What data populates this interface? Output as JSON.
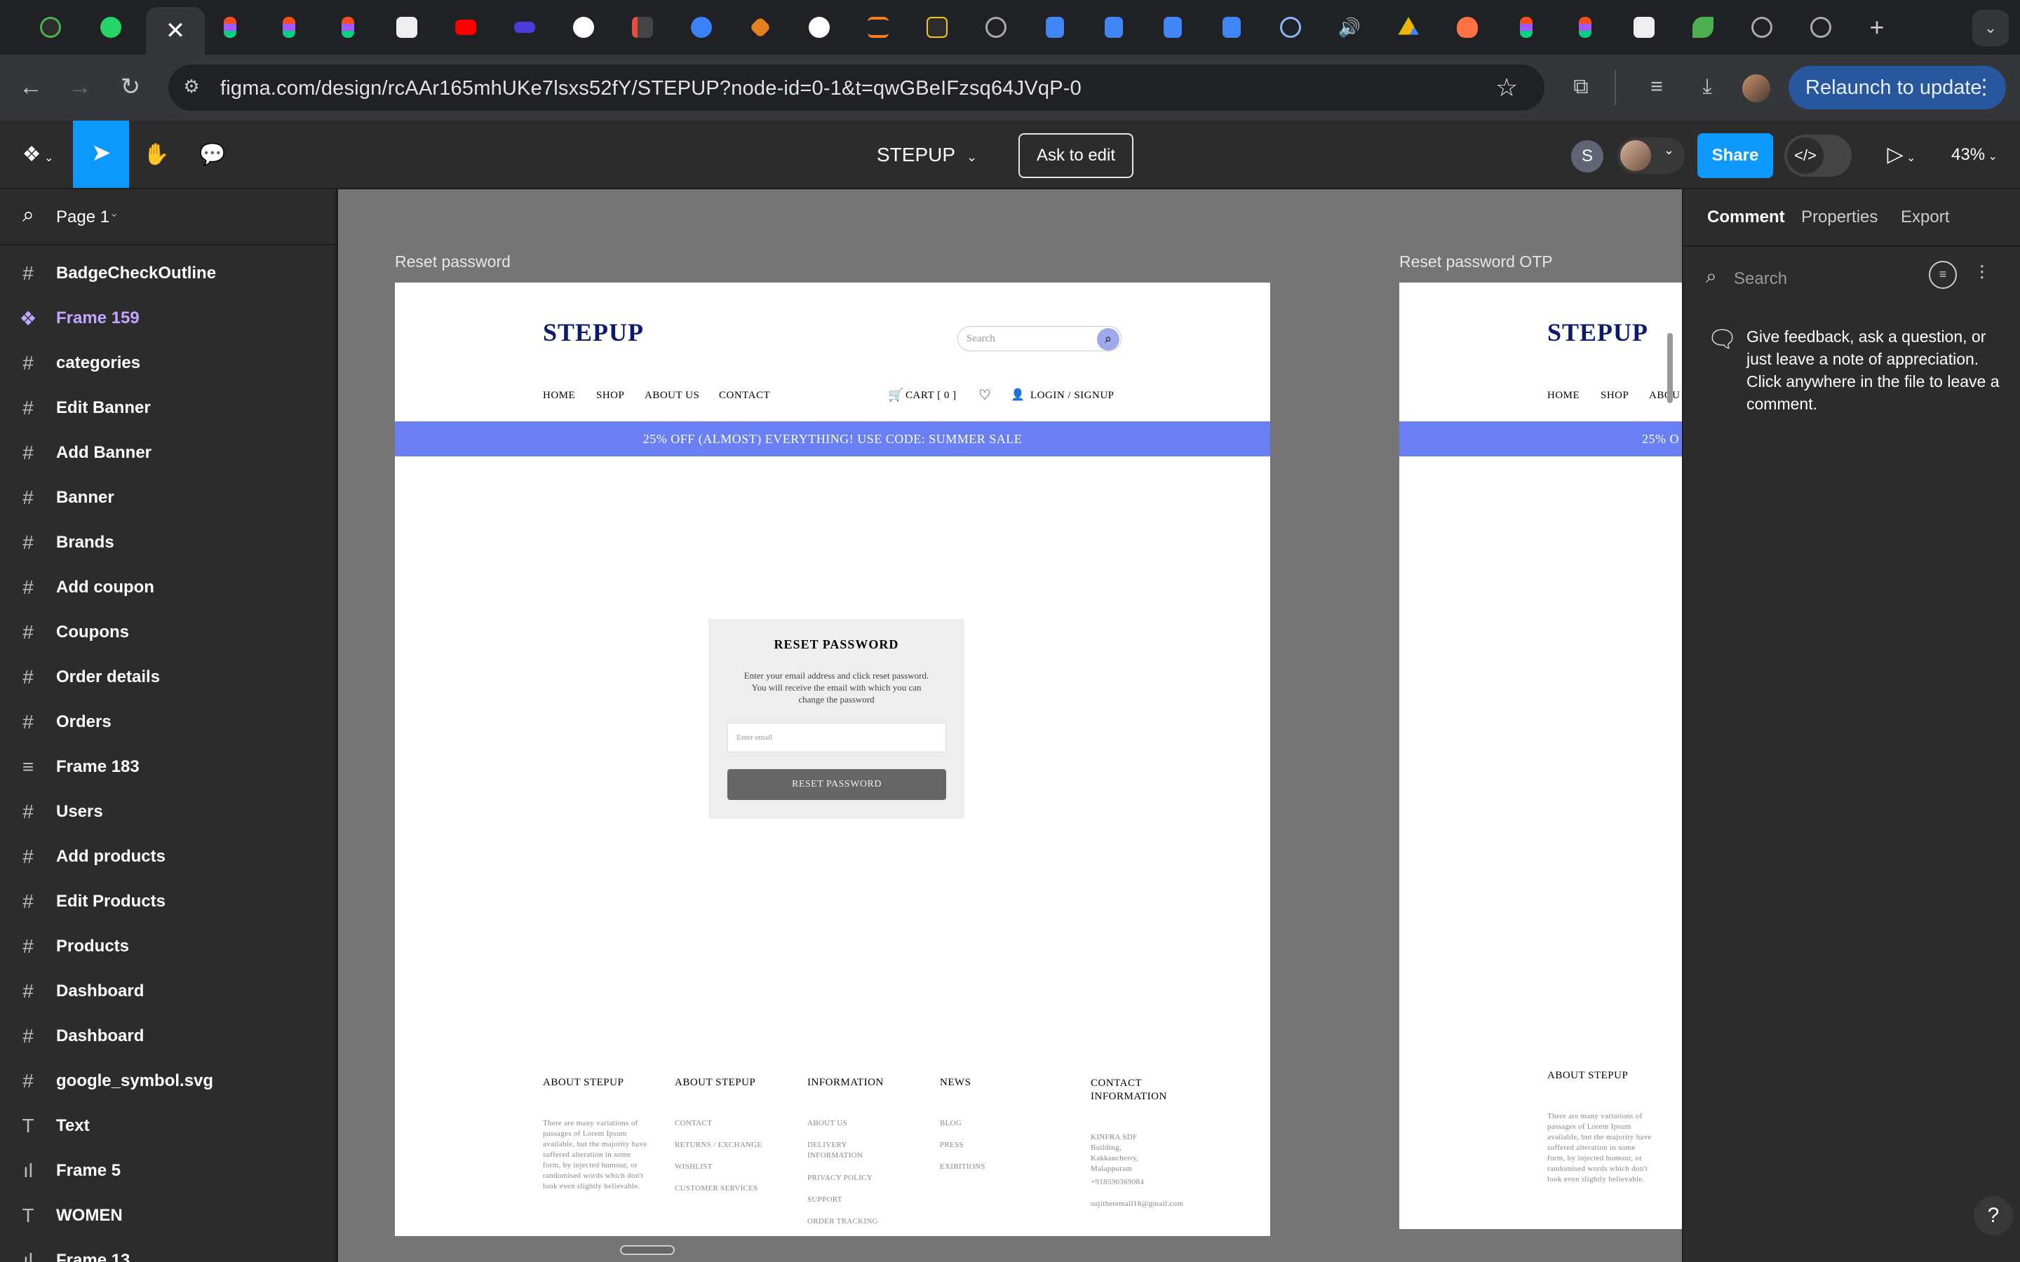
{
  "browser": {
    "url": "figma.com/design/rcAAr165mhUKe7lsxs52fY/STEPUP?node-id=0-1&t=qwGBeIFzsq64JVqP-0",
    "relaunch_label": "Relaunch to update"
  },
  "toolbar": {
    "file_name": "STEPUP",
    "ask_to_edit": "Ask to edit",
    "avatar_initial": "S",
    "share_label": "Share",
    "zoom": "43%"
  },
  "sidebar": {
    "page_label": "Page 1",
    "layers": [
      {
        "icon": "frame-icon",
        "label": "BadgeCheckOutline"
      },
      {
        "icon": "component-icon",
        "label": "Frame 159"
      },
      {
        "icon": "frame-icon",
        "label": "categories"
      },
      {
        "icon": "frame-icon",
        "label": "Edit Banner"
      },
      {
        "icon": "frame-icon",
        "label": "Add Banner"
      },
      {
        "icon": "frame-icon",
        "label": "Banner"
      },
      {
        "icon": "frame-icon",
        "label": "Brands"
      },
      {
        "icon": "frame-icon",
        "label": "Add coupon"
      },
      {
        "icon": "frame-icon",
        "label": "Coupons"
      },
      {
        "icon": "frame-icon",
        "label": "Order details"
      },
      {
        "icon": "frame-icon",
        "label": "Orders"
      },
      {
        "icon": "autolayout-icon",
        "label": "Frame 183"
      },
      {
        "icon": "frame-icon",
        "label": "Users"
      },
      {
        "icon": "frame-icon",
        "label": "Add products"
      },
      {
        "icon": "frame-icon",
        "label": "Edit Products"
      },
      {
        "icon": "frame-icon",
        "label": "Products"
      },
      {
        "icon": "frame-icon",
        "label": "Dashboard"
      },
      {
        "icon": "frame-icon",
        "label": "Dashboard"
      },
      {
        "icon": "frame-icon",
        "label": "google_symbol.svg"
      },
      {
        "icon": "text-icon",
        "label": "Text"
      },
      {
        "icon": "bars-icon",
        "label": "Frame 5"
      },
      {
        "icon": "text-icon",
        "label": "WOMEN"
      },
      {
        "icon": "bars-icon",
        "label": "Frame 13"
      }
    ]
  },
  "canvas": {
    "frame1_label": "Reset password",
    "frame2_label": "Reset password OTP",
    "site": {
      "logo": "STEPUP",
      "search_placeholder": "Search",
      "nav": {
        "home": "HOME",
        "shop": "SHOP",
        "about": "ABOUT US",
        "contact": "CONTACT",
        "cart": "CART [ 0 ]",
        "login": "LOGIN / SIGNUP"
      },
      "nav_partial_about": "ABOU",
      "promo": "25% OFF (ALMOST) EVERYTHING! USE CODE: SUMMER SALE",
      "promo_partial": "25% O",
      "reset": {
        "title": "RESET PASSWORD",
        "desc": "Enter your email address and click reset password. You will receive the email with which you can change the password",
        "email_placeholder": "Enter email",
        "button": "RESET PASSWORD"
      },
      "footer": {
        "col1_title": "ABOUT  STEPUP",
        "col1_text": "There are many variations of passages of Lorem Ipsum available, but the majority have suffered alteration in some form, by injected humour, or randomised words which don't look even slightly believable.",
        "col2_title": "ABOUT  STEPUP",
        "col2_links": [
          "CONTACT",
          "RETURNS / EXCHANGE",
          "WISHLIST",
          "CUSTOMER SERVICES"
        ],
        "col3_title": "INFORMATION",
        "col3_links": [
          "ABOUT US",
          "DELIVERY INFORMATION",
          "PRIVACY POLICY",
          "SUPPORT",
          "ORDER TRACKING"
        ],
        "col4_title": "NEWS",
        "col4_links": [
          "BLOG",
          "PRESS",
          "EXIBITIONS"
        ],
        "col5_title": "CONTACT INFORMATION",
        "col5_address": "KINFRA SDF Building, Kakkancherry, Malappuram",
        "col5_phone": "+918590369084",
        "col5_email": "sujithetemail18@gmail.com"
      }
    }
  },
  "right_panel": {
    "tabs": [
      "Comment",
      "Properties",
      "Export"
    ],
    "search_placeholder": "Search",
    "comment_hint": "Give feedback, ask a question, or just leave a note of appreciation. Click anywhere in the file to leave a comment."
  },
  "colors": {
    "accent": "#0d99ff",
    "promo": "#6b7ff5",
    "logo": "#0b1a6b",
    "component": "#c2a5ff"
  }
}
